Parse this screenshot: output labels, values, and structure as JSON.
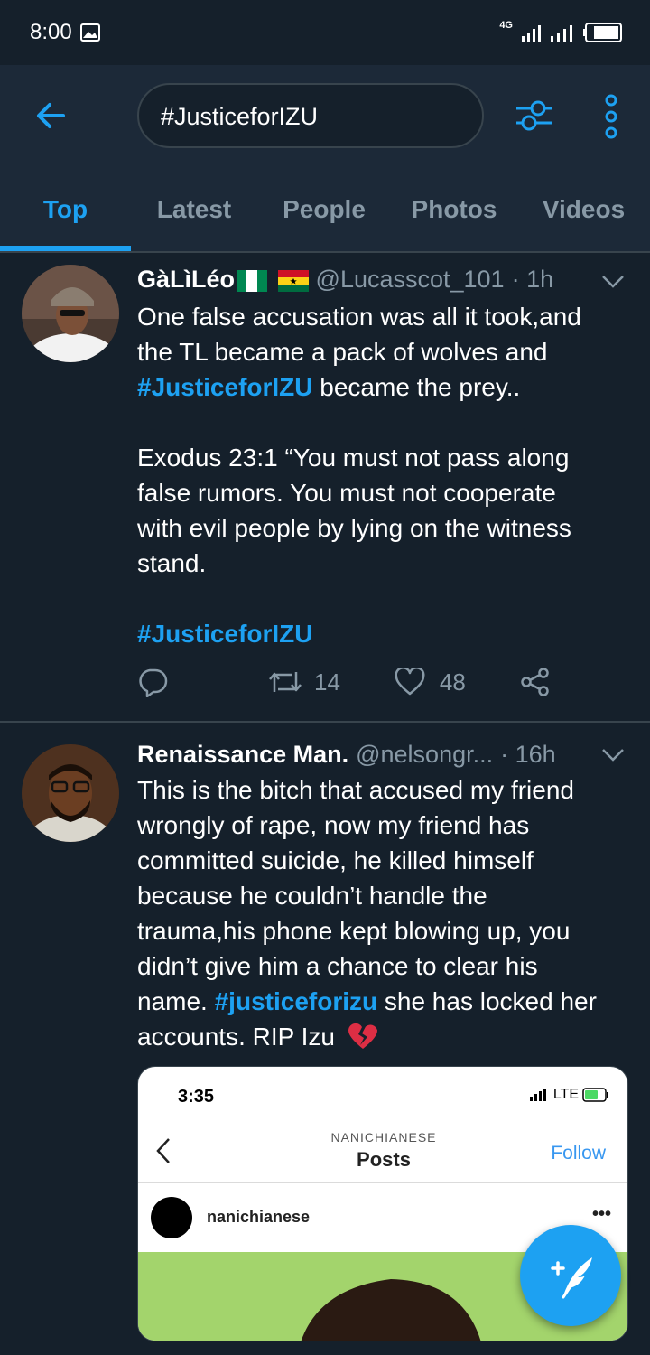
{
  "status": {
    "time": "8:00",
    "network": "4G"
  },
  "search": {
    "query": "#JusticeforIZU"
  },
  "tabs": [
    {
      "label": "Top",
      "active": true
    },
    {
      "label": "Latest"
    },
    {
      "label": "People"
    },
    {
      "label": "Photos"
    },
    {
      "label": "Videos"
    }
  ],
  "tweets": [
    {
      "name": "GàLìLéo",
      "flags": "🇳🇬🇬🇭",
      "handle": "@Lucasscot_101",
      "time": "· 1h",
      "line1": "One false accusation was all it took,and",
      "line2": "the TL became a pack of wolves and",
      "hashtag1": "#JusticeforIZU",
      "line3_rest": " became the prey..",
      "para2_l1": "Exodus 23:1 “You must not pass along",
      "para2_l2": "false rumors. You must not cooperate",
      "para2_l3": "with evil people by lying on the witness",
      "para2_l4": "stand.",
      "hashtag2": "#JusticeforIZU",
      "retweets": "14",
      "likes": "48"
    },
    {
      "name": "Renaissance Man.",
      "handle": "@nelsongr...",
      "time": "· 16h",
      "l1": "This is the bitch that accused my friend",
      "l2": "wrongly of rape, now my friend has",
      "l3": "committed suicide, he killed himself",
      "l4": "because he couldn’t handle the",
      "l5": "trauma,his phone kept blowing up, you",
      "l6": "didn’t give him a chance to clear his",
      "l7_pre": "name. ",
      "l7_tag": "#justiceforizu",
      "l7_post": " she has locked her",
      "l8": "accounts. RIP Izu",
      "emoji": "💔",
      "embed": {
        "time": "3:35",
        "network": "LTE",
        "subtitle": "NANICHIANESE",
        "title": "Posts",
        "follow": "Follow",
        "username": "nanichianese",
        "more": "•••"
      }
    }
  ],
  "colors": {
    "accent": "#1da1f2",
    "background": "#15202b",
    "header": "#1c2938",
    "muted": "#8899a6"
  }
}
